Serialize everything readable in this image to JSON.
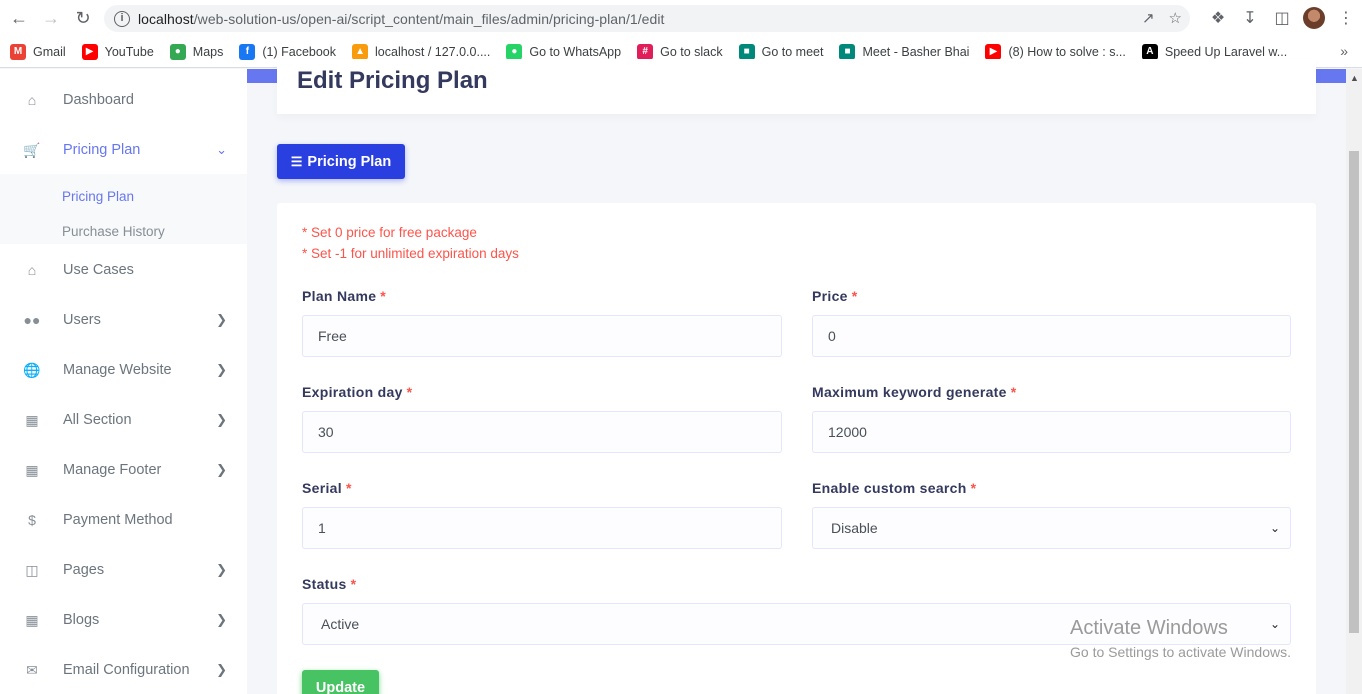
{
  "browser": {
    "url_host": "localhost",
    "url_path": "/web-solution-us/open-ai/script_content/main_files/admin/pricing-plan/1/edit",
    "bookmarks": [
      {
        "label": "Gmail",
        "icon": "gmail-icon",
        "color": "#ea4335"
      },
      {
        "label": "YouTube",
        "icon": "youtube-icon",
        "color": "#ff0000"
      },
      {
        "label": "Maps",
        "icon": "maps-icon",
        "color": "#34a853"
      },
      {
        "label": "(1) Facebook",
        "icon": "facebook-icon",
        "color": "#1877f2"
      },
      {
        "label": "localhost / 127.0.0....",
        "icon": "phpmyadmin-icon",
        "color": "#f89c0e"
      },
      {
        "label": "Go to WhatsApp",
        "icon": "whatsapp-icon",
        "color": "#25d366"
      },
      {
        "label": "Go to slack",
        "icon": "slack-icon",
        "color": "#e01e5a"
      },
      {
        "label": "Go to meet",
        "icon": "meet-icon",
        "color": "#00897b"
      },
      {
        "label": "Meet - Basher Bhai",
        "icon": "meet-icon",
        "color": "#00897b"
      },
      {
        "label": "(8) How to solve : s...",
        "icon": "youtube-icon",
        "color": "#ff0000"
      },
      {
        "label": "Speed Up Laravel w...",
        "icon": "laravel-icon",
        "color": "#000000"
      }
    ]
  },
  "sidebar": {
    "items": [
      {
        "label": "Dashboard",
        "icon": "home-icon"
      },
      {
        "label": "Pricing Plan",
        "icon": "cart-icon"
      },
      {
        "label": "Use Cases",
        "icon": "home-icon"
      },
      {
        "label": "Users",
        "icon": "users-icon"
      },
      {
        "label": "Manage Website",
        "icon": "globe-icon"
      },
      {
        "label": "All Section",
        "icon": "grid-icon"
      },
      {
        "label": "Manage Footer",
        "icon": "grid-icon"
      },
      {
        "label": "Payment Method",
        "icon": "dollar-icon"
      },
      {
        "label": "Pages",
        "icon": "columns-icon"
      },
      {
        "label": "Blogs",
        "icon": "grid-icon"
      },
      {
        "label": "Email Configuration",
        "icon": "envelope-icon"
      }
    ],
    "submenu": [
      "Pricing Plan",
      "Purchase History"
    ]
  },
  "page": {
    "title": "Edit Pricing Plan",
    "list_button": "Pricing Plan"
  },
  "form": {
    "notes": [
      "* Set 0 price for free package",
      "* Set -1 for unlimited expiration days"
    ],
    "required_mark": "*",
    "plan_name": {
      "label": "Plan Name",
      "value": "Free"
    },
    "price": {
      "label": "Price",
      "value": "0"
    },
    "expiration": {
      "label": "Expiration day",
      "value": "30"
    },
    "max_keyword": {
      "label": "Maximum keyword generate",
      "value": "12000"
    },
    "serial": {
      "label": "Serial",
      "value": "1"
    },
    "custom_search": {
      "label": "Enable custom search",
      "value": "Disable"
    },
    "status": {
      "label": "Status",
      "value": "Active"
    },
    "update_button": "Update"
  },
  "watermark": {
    "line1": "Activate Windows",
    "line2": "Go to Settings to activate Windows."
  },
  "colors": {
    "primary": "#6777ef",
    "button_primary": "#2a3fe0",
    "success": "#47c363",
    "danger": "#fc544b"
  }
}
